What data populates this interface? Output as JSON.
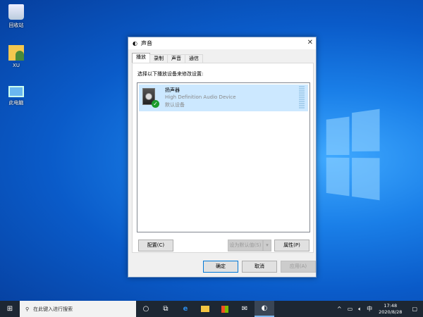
{
  "desktop": {
    "icons": [
      {
        "label": "回收站",
        "icon": "recycle-bin-icon"
      },
      {
        "label": "XU",
        "icon": "user-folder-icon"
      },
      {
        "label": "此电脑",
        "icon": "computer-icon"
      }
    ]
  },
  "dialog": {
    "title": "声音",
    "close": "✕",
    "tabs": [
      {
        "label": "播放",
        "active": true
      },
      {
        "label": "录制"
      },
      {
        "label": "声音"
      },
      {
        "label": "通信"
      }
    ],
    "instruction": "选择以下播放设备来修改设置:",
    "devices": [
      {
        "name": "扬声器",
        "description": "High Definition Audio Device",
        "status": "默认设备",
        "selected": true
      }
    ],
    "buttons": {
      "configure": "配置(C)",
      "set_default": "设为默认值(S)",
      "properties": "属性(P)",
      "ok": "确定",
      "cancel": "取消",
      "apply": "应用(A)"
    }
  },
  "taskbar": {
    "search_placeholder": "在此键入进行搜索",
    "tray": {
      "ime": "中",
      "time": "17:48",
      "date": "2020/8/28"
    }
  },
  "colors": {
    "accent": "#0078d7",
    "selection": "#cce8ff",
    "taskbar": "#1d2733"
  }
}
